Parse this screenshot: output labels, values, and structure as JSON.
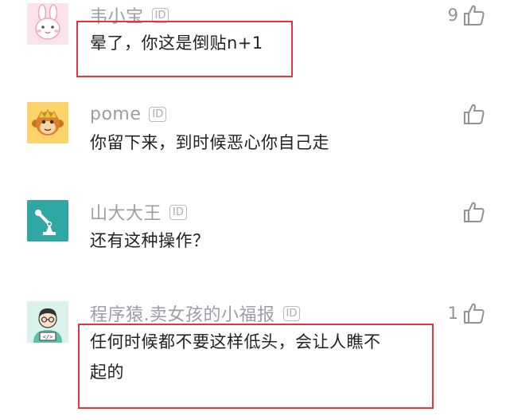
{
  "comments": [
    {
      "username": "韦小宝",
      "id_badge": "ID",
      "text_line1": "晕了，你这是倒贴n+1",
      "like_count": "9",
      "avatar": "bunny-avatar"
    },
    {
      "username": "pome",
      "id_badge": "ID",
      "text_line1": "你留下来，到时候恶心你自己走",
      "like_count": "",
      "avatar": "monkey-avatar"
    },
    {
      "username": "山大大王",
      "id_badge": "ID",
      "text_line1": "还有这种操作？",
      "like_count": "",
      "avatar": "robot-arm-avatar"
    },
    {
      "username": "程序猿.卖女孩的小福报",
      "id_badge": "ID",
      "text_line1": "任何时候都不要这样低头，会让人瞧不",
      "text_line2": "起的",
      "like_count": "1",
      "avatar": "programmer-avatar"
    }
  ],
  "icons": {
    "like": "thumbs-up-icon"
  },
  "colors": {
    "highlight": "#e0343f",
    "username": "#9a9ea6",
    "text": "#222222"
  }
}
